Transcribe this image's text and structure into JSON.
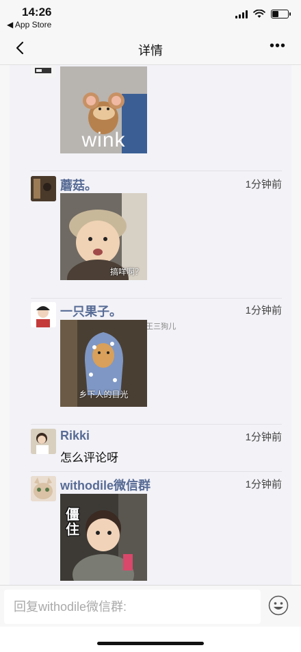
{
  "status": {
    "time": "14:26",
    "back_app": "◀ App Store"
  },
  "nav": {
    "title": "详情"
  },
  "comments": [
    {
      "username": "",
      "time": "",
      "sticker_caption": "wink"
    },
    {
      "username": "蘑菇。",
      "time": "1分钟前",
      "sticker_caption": "搞咩啊？"
    },
    {
      "username": "一只果子。",
      "time": "1分钟前",
      "sticker_caption": "乡下人的目光",
      "watermark": "@王三狗儿"
    },
    {
      "username": "Rikki",
      "time": "1分钟前",
      "text": "怎么评论呀"
    },
    {
      "username": "withodile微信群",
      "time": "1分钟前",
      "sticker_caption": "僵住"
    }
  ],
  "reply": {
    "placeholder": "回复withodile微信群:"
  },
  "colors": {
    "username": "#576b95",
    "panel": "#f2f2f7"
  }
}
